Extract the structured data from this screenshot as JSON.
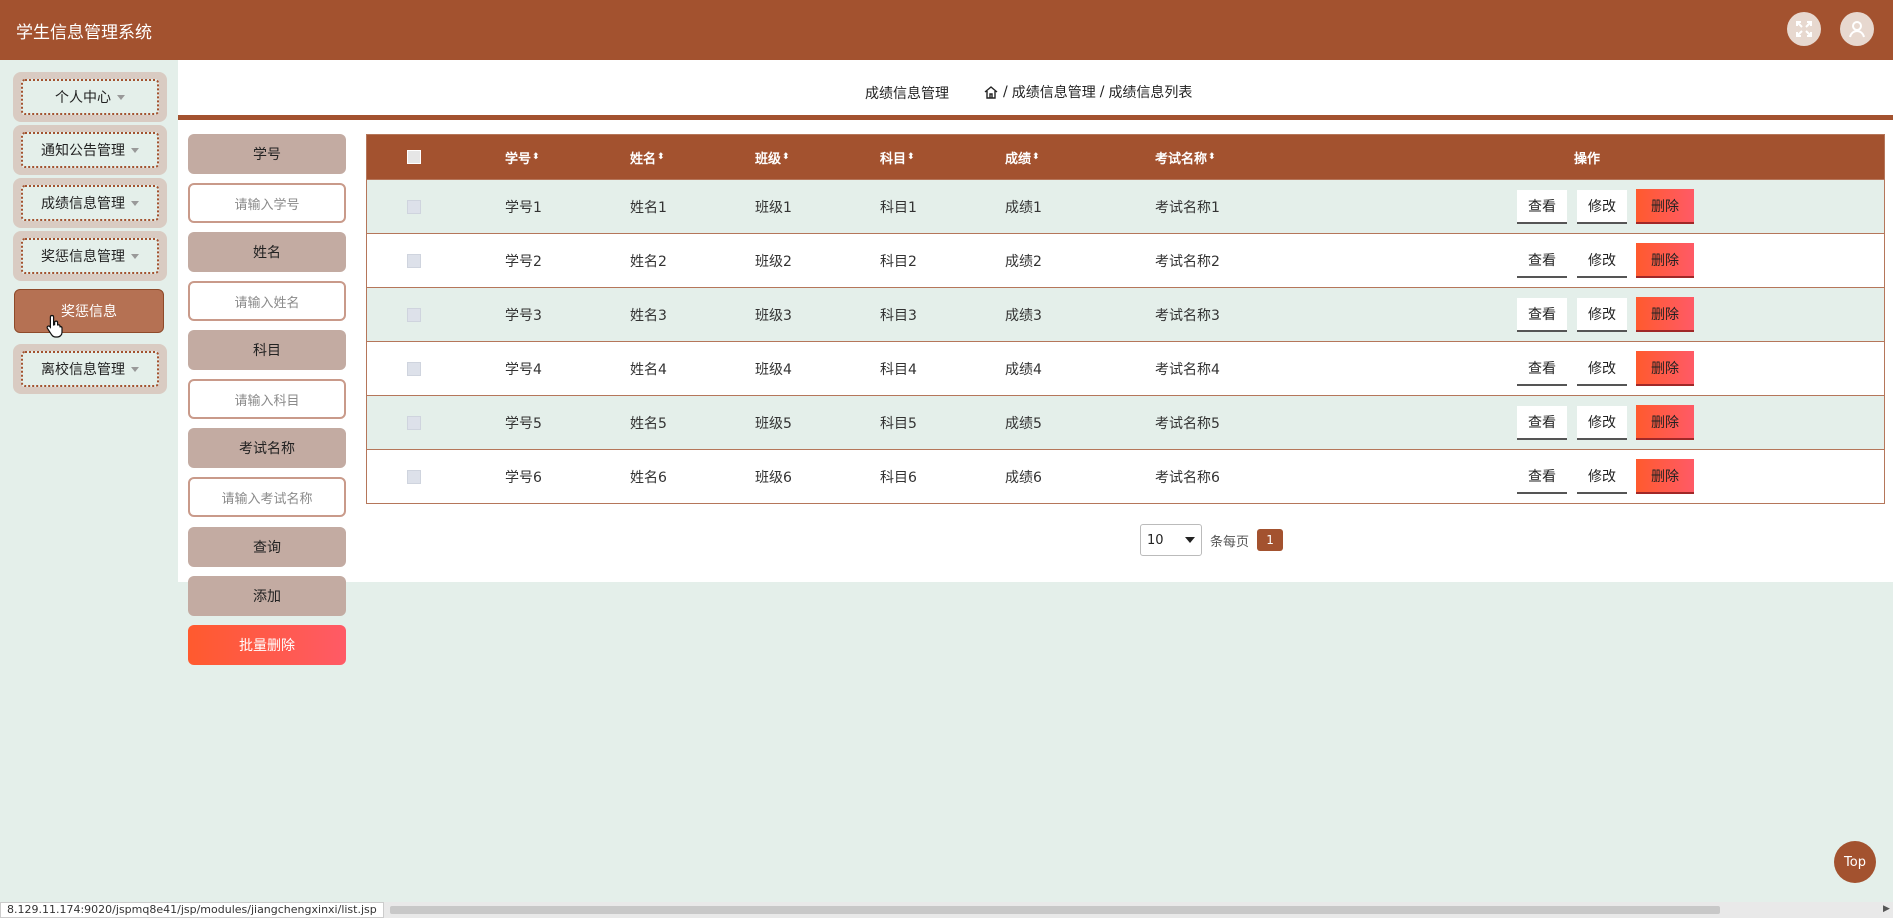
{
  "app": {
    "title": "学生信息管理系统"
  },
  "header_icons": [
    "fullscreen-icon",
    "user-icon"
  ],
  "sidebar": {
    "menus": [
      {
        "label": "个人中心"
      },
      {
        "label": "通知公告管理"
      },
      {
        "label": "成绩信息管理"
      },
      {
        "label": "奖惩信息管理"
      }
    ],
    "active_item": {
      "label": "奖惩信息"
    },
    "last_menu": {
      "label": "离校信息管理"
    }
  },
  "breadcrumb": {
    "title": "成绩信息管理",
    "sep": "/",
    "path1": "成绩信息管理",
    "path2": "成绩信息列表"
  },
  "search": {
    "student_no_label": "学号",
    "student_no_placeholder": "请输入学号",
    "name_label": "姓名",
    "name_placeholder": "请输入姓名",
    "subject_label": "科目",
    "subject_placeholder": "请输入科目",
    "exam_label": "考试名称",
    "exam_placeholder": "请输入考试名称",
    "query_label": "查询",
    "add_label": "添加",
    "batch_delete_label": "批量删除"
  },
  "table": {
    "headers": {
      "student_no": "学号",
      "name": "姓名",
      "class": "班级",
      "subject": "科目",
      "score": "成绩",
      "exam": "考试名称",
      "ops": "操作"
    },
    "sort_glyph": "⬍",
    "ops": {
      "view": "查看",
      "edit": "修改",
      "delete": "删除"
    },
    "rows": [
      {
        "student_no": "学号1",
        "name": "姓名1",
        "class": "班级1",
        "subject": "科目1",
        "score": "成绩1",
        "exam": "考试名称1"
      },
      {
        "student_no": "学号2",
        "name": "姓名2",
        "class": "班级2",
        "subject": "科目2",
        "score": "成绩2",
        "exam": "考试名称2"
      },
      {
        "student_no": "学号3",
        "name": "姓名3",
        "class": "班级3",
        "subject": "科目3",
        "score": "成绩3",
        "exam": "考试名称3"
      },
      {
        "student_no": "学号4",
        "name": "姓名4",
        "class": "班级4",
        "subject": "科目4",
        "score": "成绩4",
        "exam": "考试名称4"
      },
      {
        "student_no": "学号5",
        "name": "姓名5",
        "class": "班级5",
        "subject": "科目5",
        "score": "成绩5",
        "exam": "考试名称5"
      },
      {
        "student_no": "学号6",
        "name": "姓名6",
        "class": "班级6",
        "subject": "科目6",
        "score": "成绩6",
        "exam": "考试名称6"
      }
    ]
  },
  "pager": {
    "page_size": "10",
    "per_page_text": "条每页",
    "current_page": "1"
  },
  "top_button": "Top",
  "status_url": "8.129.11.174:9020/jspmq8e41/jsp/modules/jiangchengxinxi/list.jsp",
  "colors": {
    "primary": "#a3522f",
    "background": "#e4efea",
    "danger": "#ff5a2e"
  }
}
